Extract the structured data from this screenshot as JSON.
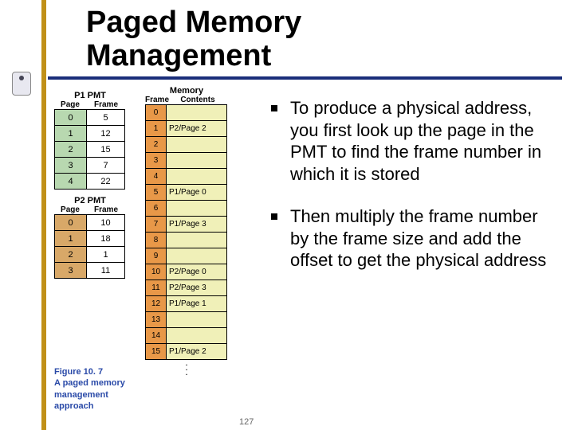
{
  "title_line1": "Paged Memory",
  "title_line2": "Management",
  "p1": {
    "title": "P1 PMT",
    "head_page": "Page",
    "head_frame": "Frame",
    "rows": [
      {
        "page": "0",
        "frame": "5"
      },
      {
        "page": "1",
        "frame": "12"
      },
      {
        "page": "2",
        "frame": "15"
      },
      {
        "page": "3",
        "frame": "7"
      },
      {
        "page": "4",
        "frame": "22"
      }
    ]
  },
  "p2": {
    "title": "P2 PMT",
    "head_page": "Page",
    "head_frame": "Frame",
    "rows": [
      {
        "page": "0",
        "frame": "10"
      },
      {
        "page": "1",
        "frame": "18"
      },
      {
        "page": "2",
        "frame": "1"
      },
      {
        "page": "3",
        "frame": "11"
      }
    ]
  },
  "memory": {
    "title": "Memory",
    "head_frame": "Frame",
    "head_contents": "Contents",
    "rows": [
      {
        "frame": "0",
        "contents": ""
      },
      {
        "frame": "1",
        "contents": "P2/Page 2"
      },
      {
        "frame": "2",
        "contents": ""
      },
      {
        "frame": "3",
        "contents": ""
      },
      {
        "frame": "4",
        "contents": ""
      },
      {
        "frame": "5",
        "contents": "P1/Page 0"
      },
      {
        "frame": "6",
        "contents": ""
      },
      {
        "frame": "7",
        "contents": "P1/Page 3"
      },
      {
        "frame": "8",
        "contents": ""
      },
      {
        "frame": "9",
        "contents": ""
      },
      {
        "frame": "10",
        "contents": "P2/Page 0"
      },
      {
        "frame": "11",
        "contents": "P2/Page 3"
      },
      {
        "frame": "12",
        "contents": "P1/Page 1"
      },
      {
        "frame": "13",
        "contents": ""
      },
      {
        "frame": "14",
        "contents": ""
      },
      {
        "frame": "15",
        "contents": "P1/Page 2"
      }
    ]
  },
  "caption": {
    "figno": "Figure 10. 7",
    "text": "A paged memory management approach"
  },
  "bullets": [
    "To produce a physical address, you first look up the page in the PMT to find the frame number in which it is stored",
    "Then multiply the frame number by the frame size and add the offset to get the physical address"
  ],
  "page_number": "127",
  "colors": {
    "accent_stripe": "#c09018",
    "underline": "#1a2e7a",
    "p1_page_bg": "#b8d8b0",
    "p2_page_bg": "#d8a868",
    "mem_frame_bg": "#e89848",
    "mem_content_bg": "#f0f0b8"
  }
}
